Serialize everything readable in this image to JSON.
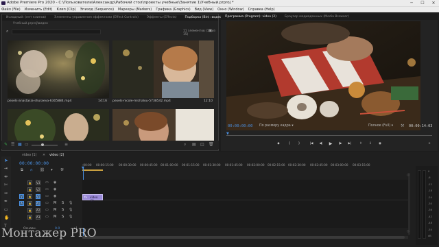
{
  "window": {
    "title": "Adobe Premiere Pro 2020 - C:\\Пользователи\\Александр\\Рабочий стол\\проекты учебные\\Занятие 1\\Учебный.prproj *",
    "controls": [
      "─",
      "☐",
      "✕"
    ]
  },
  "menu": [
    "Файл (File)",
    "Изменить (Edit)",
    "Клип (Clip)",
    "Эпизод (Sequence)",
    "Маркеры (Markers)",
    "Графика (Graphics)",
    "Вид (View)",
    "Окно (Window)",
    "Справка (Help)"
  ],
  "left_tabs": [
    "Исходный: (нет клипов)",
    "Элементы управления эффектами (Effect Controls)",
    "Эффекты (Effects)",
    "Подборка (Bin): видео"
  ],
  "bin": {
    "path": "Учебный.prproj\\видео",
    "count": "11 элементов (11 из 15)",
    "search_placeholder": "",
    "items": [
      {
        "name": "pexels-anastasia-shuraeva-6305884.mp4",
        "duration": "14:16"
      },
      {
        "name": "pexels-nicole-michalou-5738542.mp4",
        "duration": "12:10"
      }
    ]
  },
  "program": {
    "tab_label": "Программа (Program): video (2)",
    "tab_other": "Браузер медиаданных (Media Browser)",
    "timecode": "00:00:00:00",
    "fit": "По размеру кадра",
    "quality": "Полное (Full)",
    "duration": "00:00:14:03"
  },
  "timeline": {
    "tabs": [
      "video (1)",
      "video (2)"
    ],
    "timecode": "00:00:00:00",
    "ruler": [
      ":00:00",
      "00:00:15:00",
      "00:00:30:00",
      "00:00:45:00",
      "00:01:00:00",
      "00:01:15:00",
      "00:01:30:00",
      "00:01:45:00",
      "00:02:00:00",
      "00:02:15:00",
      "00:02:30:00",
      "00:02:45:00",
      "00:03:00:00",
      "00:03:15:00"
    ],
    "tracks": [
      {
        "name": "V3"
      },
      {
        "name": "V2"
      },
      {
        "name": "V1"
      },
      {
        "name": "A1",
        "m": "M",
        "s": "S"
      },
      {
        "name": "A2",
        "m": "M",
        "s": "S"
      },
      {
        "name": "A3",
        "m": "M",
        "s": "S"
      }
    ],
    "clip_label": "video (2)",
    "master_label": "Основн.",
    "master_value": "0.0"
  },
  "meter_scale": [
    "0",
    "-6",
    "-12",
    "-18",
    "-24",
    "-30",
    "-36",
    "-42",
    "-48",
    "-54",
    "dB"
  ],
  "watermark": "Монтажер PRO"
}
